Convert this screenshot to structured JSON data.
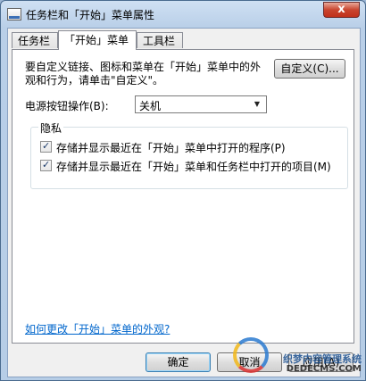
{
  "window": {
    "title": "任务栏和「开始」菜单属性",
    "close_symbol": "x"
  },
  "tabs": [
    {
      "label": "任务栏",
      "active": false
    },
    {
      "label": "「开始」菜单",
      "active": true
    },
    {
      "label": "工具栏",
      "active": false
    }
  ],
  "panel": {
    "description": "要自定义链接、图标和菜单在「开始」菜单中的外观和行为，请单击\"自定义\"。",
    "customize_button": "自定义(C)...",
    "power_label": "电源按钮操作(B):",
    "power_value": "关机",
    "privacy": {
      "title": "隐私",
      "items": [
        {
          "label": "存储并显示最近在「开始」菜单中打开的程序(P)",
          "checked": true
        },
        {
          "label": "存储并显示最近在「开始」菜单和任务栏中打开的项目(M)",
          "checked": true
        }
      ]
    },
    "link": "如何更改「开始」菜单的外观?"
  },
  "buttons": {
    "ok": "确定",
    "cancel": "取消",
    "apply": "应用(A)"
  },
  "watermark": {
    "line1": "织梦内容管理系统",
    "line2": "DEDECMS.COM"
  },
  "icons": {
    "check": "✓",
    "dropdown": "▼"
  }
}
